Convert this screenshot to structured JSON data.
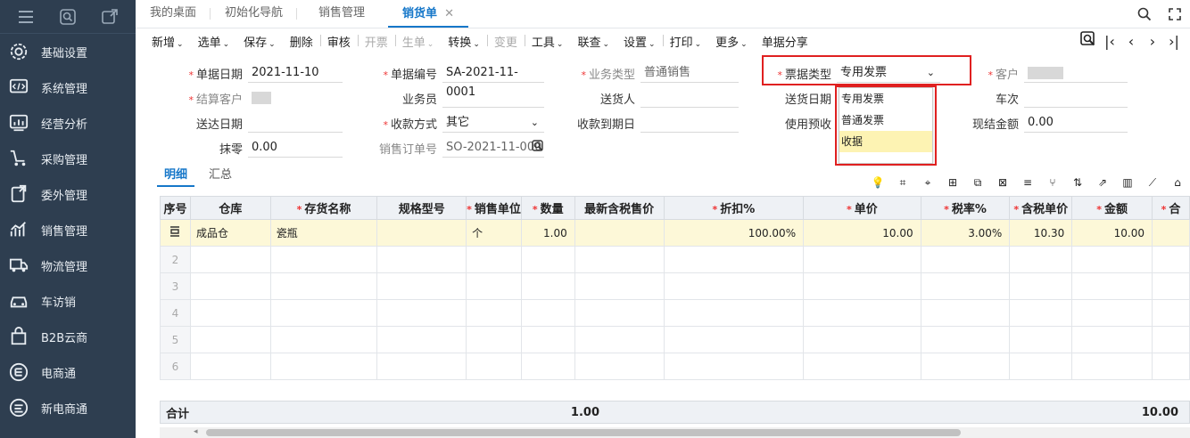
{
  "sidebar": {
    "top_icons": [
      "menu-icon",
      "search-icon",
      "new-window-icon"
    ],
    "items": [
      {
        "label": "基础设置",
        "icon": "gear-icon"
      },
      {
        "label": "系统管理",
        "icon": "code-icon"
      },
      {
        "label": "经营分析",
        "icon": "chart-icon"
      },
      {
        "label": "采购管理",
        "icon": "cart-icon"
      },
      {
        "label": "委外管理",
        "icon": "outsource-icon"
      },
      {
        "label": "销售管理",
        "icon": "sales-icon"
      },
      {
        "label": "物流管理",
        "icon": "truck-icon"
      },
      {
        "label": "车访销",
        "icon": "car-icon"
      },
      {
        "label": "B2B云商",
        "icon": "shop-icon"
      },
      {
        "label": "电商通",
        "icon": "ecommerce-icon"
      },
      {
        "label": "新电商通",
        "icon": "new-ecommerce-icon"
      }
    ]
  },
  "tabs": [
    {
      "label": "我的桌面"
    },
    {
      "label": "初始化导航"
    },
    {
      "label": "销售管理"
    },
    {
      "label": "销货单",
      "close": "✕"
    }
  ],
  "toolbar": [
    {
      "label": "新增",
      "caret": true
    },
    {
      "label": "选单",
      "caret": true
    },
    {
      "label": "保存",
      "caret": true
    },
    {
      "label": "删除"
    },
    {
      "label": "审核",
      "bar": true
    },
    {
      "label": "开票",
      "disabled": true,
      "bar": true
    },
    {
      "label": "生单",
      "caret": true,
      "disabled": true,
      "bar": true
    },
    {
      "label": "转换",
      "caret": true
    },
    {
      "label": "变更",
      "disabled": true,
      "bar": true
    },
    {
      "label": "工具",
      "caret": true,
      "bar": true
    },
    {
      "label": "联查",
      "caret": true
    },
    {
      "label": "设置",
      "caret": true
    },
    {
      "label": "打印",
      "caret": true,
      "bar": true
    },
    {
      "label": "更多",
      "caret": true
    },
    {
      "label": "单据分享"
    }
  ],
  "form": {
    "doc_date": {
      "label": "单据日期",
      "value": "2021-11-10"
    },
    "doc_no": {
      "label": "单据编号",
      "value": "SA-2021-11-0001"
    },
    "biz_type": {
      "label": "业务类型",
      "value": "普通销售"
    },
    "invoice_type": {
      "label": "票据类型",
      "value": "专用发票"
    },
    "customer": {
      "label": "客户"
    },
    "settle_customer": {
      "label": "结算客户"
    },
    "salesman": {
      "label": "业务员"
    },
    "delivery_person": {
      "label": "送货人"
    },
    "delivery_date": {
      "label": "送货日期"
    },
    "train_no": {
      "label": "车次"
    },
    "arrival_date": {
      "label": "送达日期"
    },
    "payment_method": {
      "label": "收款方式",
      "value": "其它"
    },
    "due_date": {
      "label": "收款到期日"
    },
    "use_prepay": {
      "label": "使用预收"
    },
    "cash_amount": {
      "label": "现结金额",
      "value": "0.00"
    },
    "rounding": {
      "label": "抹零",
      "value": "0.00"
    },
    "sales_order_no": {
      "label": "销售订单号",
      "value": "SO-2021-11-000"
    }
  },
  "invoice_dropdown": {
    "options": [
      "专用发票",
      "普通发票",
      "收据"
    ],
    "highlighted": "收据"
  },
  "subtabs": [
    {
      "label": "明细"
    },
    {
      "label": "汇总"
    }
  ],
  "grid": {
    "headers": [
      {
        "label": "序号"
      },
      {
        "label": "仓库"
      },
      {
        "label": "存货名称",
        "req": true
      },
      {
        "label": "规格型号"
      },
      {
        "label": "销售单位",
        "req": true
      },
      {
        "label": "数量",
        "req": true
      },
      {
        "label": "最新含税售价"
      },
      {
        "label": "折扣%",
        "req": true
      },
      {
        "label": "单价",
        "req": true
      },
      {
        "label": "税率%",
        "req": true
      },
      {
        "label": "含税单价",
        "req": true
      },
      {
        "label": "金额",
        "req": true
      },
      {
        "label": "合",
        "req": true
      }
    ],
    "row1": [
      "成品仓",
      "瓷瓶",
      "",
      "个",
      "1.00",
      "",
      "100.00%",
      "10.00",
      "3.00%",
      "10.30",
      "10.00"
    ],
    "empty_rows": [
      "2",
      "3",
      "4",
      "5",
      "6"
    ]
  },
  "footer": {
    "label": "合计",
    "qty": "1.00",
    "amount": "10.00"
  }
}
